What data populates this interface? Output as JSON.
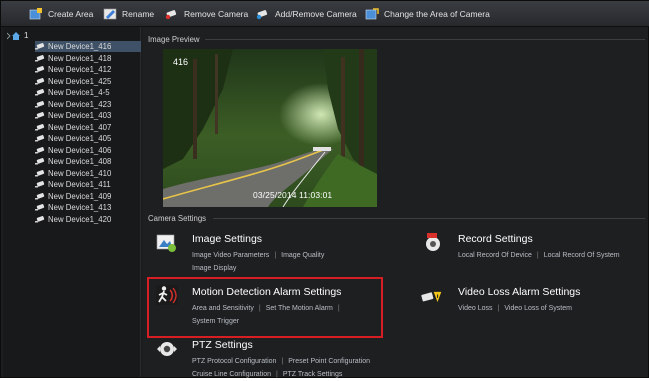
{
  "toolbar": {
    "create_area": "Create Area",
    "rename": "Rename",
    "remove_camera": "Remove Camera",
    "add_remove_camera": "Add/Remove Camera",
    "change_area": "Change the Area of Camera"
  },
  "tree": {
    "root_label": "1",
    "devices": [
      "New Device1_416",
      "New Device1_418",
      "New Device1_412",
      "New Device1_425",
      "New Device1_4-5",
      "New Device1_423",
      "New Device1_403",
      "New Device1_407",
      "New Device1_405",
      "New Device1_406",
      "New Device1_408",
      "New Device1_410",
      "New Device1_411",
      "New Device1_409",
      "New Device1_413",
      "New Device1_420"
    ]
  },
  "preview": {
    "section_title": "Image Preview",
    "channel": "416",
    "timestamp": "03/25/2014  11:03:01"
  },
  "camera_settings": {
    "section_title": "Camera Settings",
    "image_settings": {
      "title": "Image Settings",
      "link1": "Image Video Parameters",
      "link2": "Image Quality",
      "link3": "Image Display"
    },
    "record_settings": {
      "title": "Record Settings",
      "link1": "Local Record Of Device",
      "link2": "Local Record Of System"
    },
    "motion_settings": {
      "title": "Motion Detection Alarm Settings",
      "link1": "Area and Sensitivity",
      "link2": "Set The Motion Alarm",
      "link3": "System Trigger"
    },
    "video_loss_settings": {
      "title": "Video Loss Alarm Settings",
      "link1": "Video Loss",
      "link2": "Video Loss of System"
    },
    "ptz_settings": {
      "title": "PTZ Settings",
      "link1": "PTZ Protocol Configuration",
      "link2": "Preset Point Configuration",
      "link3": "Cruise Line Configuration",
      "link4": "PTZ Track Settings"
    }
  },
  "colors": {
    "highlight": "#d81e25",
    "selection": "#3f5166"
  }
}
